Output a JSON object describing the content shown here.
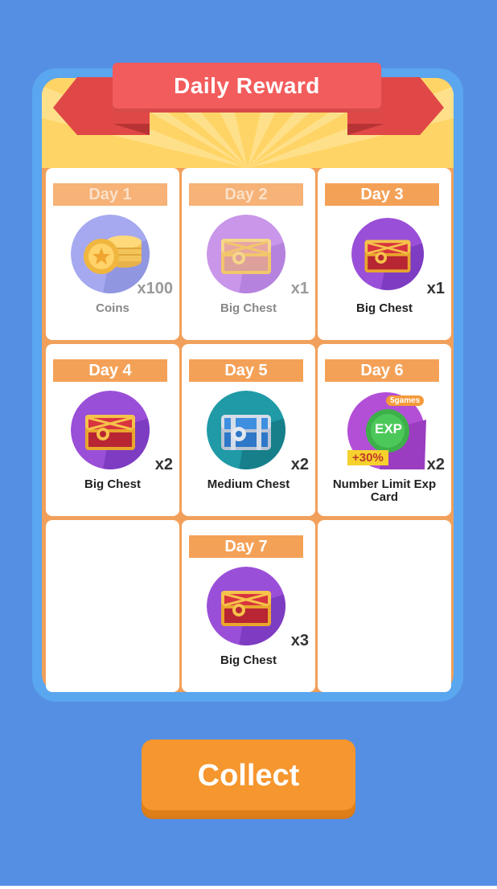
{
  "header": {
    "title": "Daily Reward"
  },
  "rewards": [
    {
      "day": "Day 1",
      "item": "Coins",
      "qty": "x100",
      "icon": "coins-icon",
      "claimed": true
    },
    {
      "day": "Day 2",
      "item": "Big Chest",
      "qty": "x1",
      "icon": "big-chest-icon",
      "claimed": true
    },
    {
      "day": "Day 3",
      "item": "Big Chest",
      "qty": "x1",
      "icon": "big-chest-icon",
      "claimed": false
    },
    {
      "day": "Day 4",
      "item": "Big Chest",
      "qty": "x2",
      "icon": "big-chest-icon",
      "claimed": false
    },
    {
      "day": "Day 5",
      "item": "Medium Chest",
      "qty": "x2",
      "icon": "medium-chest-icon",
      "claimed": false
    },
    {
      "day": "Day 6",
      "item": "Number Limit Exp Card",
      "qty": "x2",
      "icon": "exp-card-icon",
      "claimed": false,
      "badge_top": "5games",
      "badge_center": "EXP",
      "badge_bottom": "+30%"
    },
    {
      "day": "Day 7",
      "item": "Big Chest",
      "qty": "x3",
      "icon": "big-chest-icon",
      "claimed": false
    }
  ],
  "actions": {
    "collect_label": "Collect"
  },
  "colors": {
    "background": "#558fe3",
    "panel": "#5aa6ef",
    "ribbon": "#f35c5c",
    "day_label": "#f4a158",
    "button": "#f5962e"
  }
}
